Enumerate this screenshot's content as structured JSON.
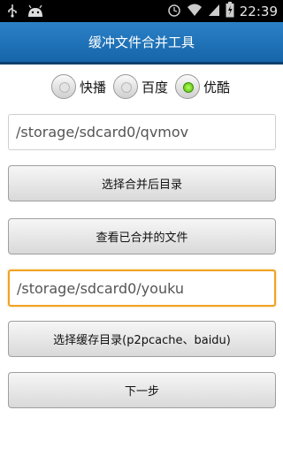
{
  "status_bar": {
    "time": "22:39",
    "left_icons": [
      "usb-icon",
      "android-icon"
    ],
    "right_icons": [
      "alarm-icon",
      "wifi-icon",
      "signal-icon",
      "battery-icon"
    ]
  },
  "title": "缓冲文件合并工具",
  "source_options": [
    {
      "label": "快播",
      "checked": false
    },
    {
      "label": "百度",
      "checked": false
    },
    {
      "label": "优酷",
      "checked": true
    }
  ],
  "output_path": {
    "value": "/storage/sdcard0/qvmov"
  },
  "buttons": {
    "choose_output_dir": "选择合并后目录",
    "view_merged_files": "查看已合并的文件",
    "choose_cache_dir": "选择缓存目录(p2pcache、baidu)",
    "next_step": "下一步"
  },
  "cache_path": {
    "value": "/storage/sdcard0/youku"
  },
  "colors": {
    "title_bar": "#1f73bb",
    "focus_border": "#f0a224",
    "radio_checked": "#5bc01a"
  }
}
